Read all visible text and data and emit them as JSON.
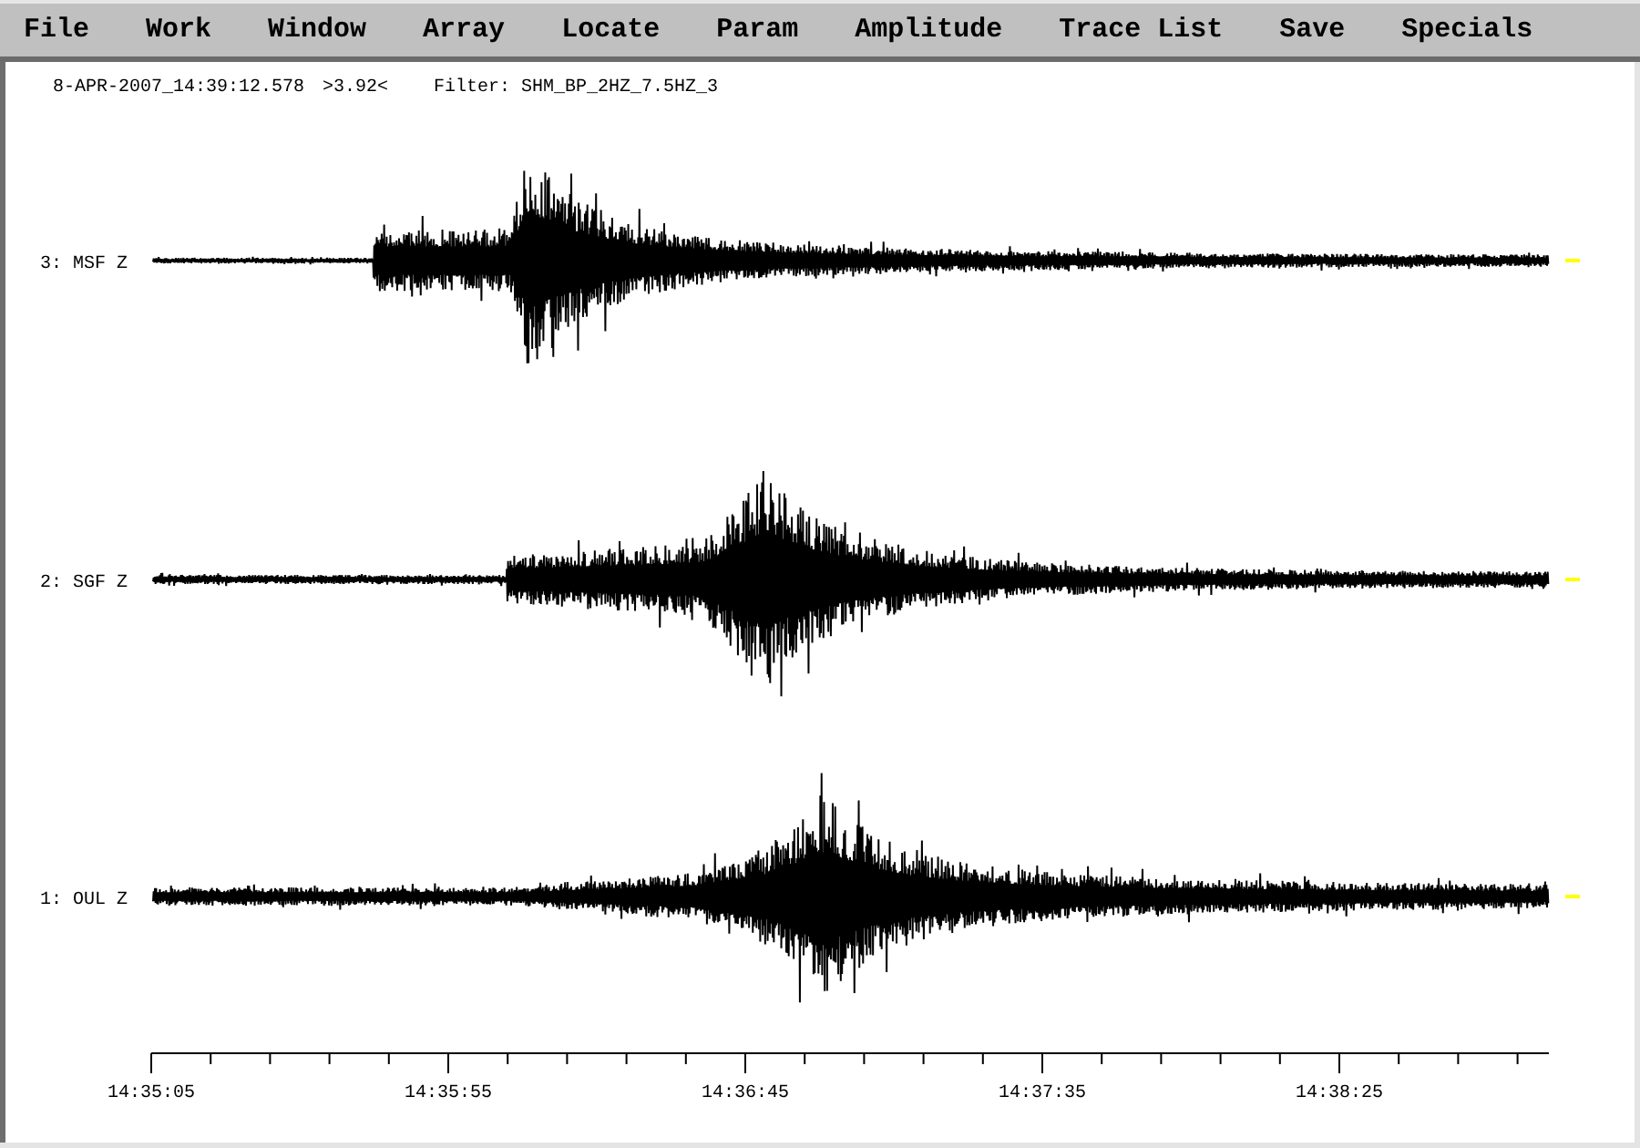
{
  "menu": [
    "File",
    "Work",
    "Window",
    "Array",
    "Locate",
    "Param",
    "Amplitude",
    "Trace List",
    "Save",
    "Specials"
  ],
  "header": {
    "timestamp": "8-APR-2007_14:39:12.578",
    "readout": ">3.92<",
    "filter": "Filter: SHM_BP_2HZ_7.5HZ_3"
  },
  "traces": [
    {
      "label": "3: MSF Z"
    },
    {
      "label": "2: SGF Z"
    },
    {
      "label": "1: OUL Z"
    }
  ],
  "time_axis": {
    "labels": [
      "14:35:05",
      "14:35:55",
      "14:36:45",
      "14:37:35",
      "14:38:25"
    ]
  }
}
